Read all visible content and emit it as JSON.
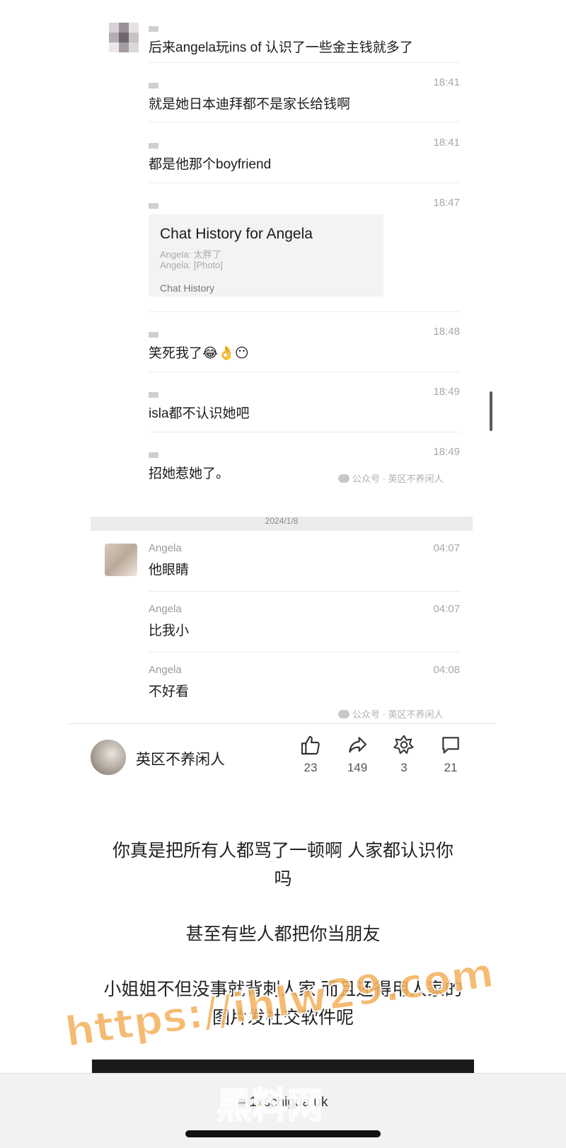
{
  "messages_group1": [
    {
      "time": "",
      "text": "后来angela玩ins of 认识了一些金主钱就多了"
    },
    {
      "time": "18:41",
      "text": "就是她日本迪拜都不是家长给钱啊"
    },
    {
      "time": "18:41",
      "text": "都是他那个boyfriend"
    },
    {
      "time": "18:47",
      "card": {
        "title": "Chat History for Angela",
        "line1": "Angela: 太胖了",
        "line2": "Angela: [Photo]",
        "footer": "Chat History"
      }
    },
    {
      "time": "18:48",
      "text": "笑死我了😂👌😶"
    },
    {
      "time": "18:49",
      "text": "isla都不认识她吧"
    },
    {
      "time": "18:49",
      "text": "招她惹她了。"
    }
  ],
  "watermark_text": "公众号 · 英区不养闲人",
  "date_divider": "2024/1/8",
  "messages_group2": [
    {
      "sender": "Angela",
      "time": "04:07",
      "text": "他眼睛"
    },
    {
      "sender": "Angela",
      "time": "04:07",
      "text": "比我小"
    },
    {
      "sender": "Angela",
      "time": "04:08",
      "text": "不好看"
    }
  ],
  "author": {
    "name": "英区不养闲人"
  },
  "actions": [
    {
      "icon": "thumbs-up-icon",
      "count": "23"
    },
    {
      "icon": "share-icon",
      "count": "149"
    },
    {
      "icon": "star-icon",
      "count": "3"
    },
    {
      "icon": "comment-icon",
      "count": "21"
    }
  ],
  "comment_lines": [
    "你真是把所有人都骂了一顿啊 人家都认识你",
    "吗",
    "甚至有些人都把你当朋友",
    "小姐姐不但没事就背刺人家 而且还得用人家的",
    "图片发社交软件呢"
  ],
  "browser": {
    "url": "1xschigua.uk"
  },
  "overlay_watermark": {
    "url": "https://ihlw29.com",
    "name": "黑料网"
  }
}
